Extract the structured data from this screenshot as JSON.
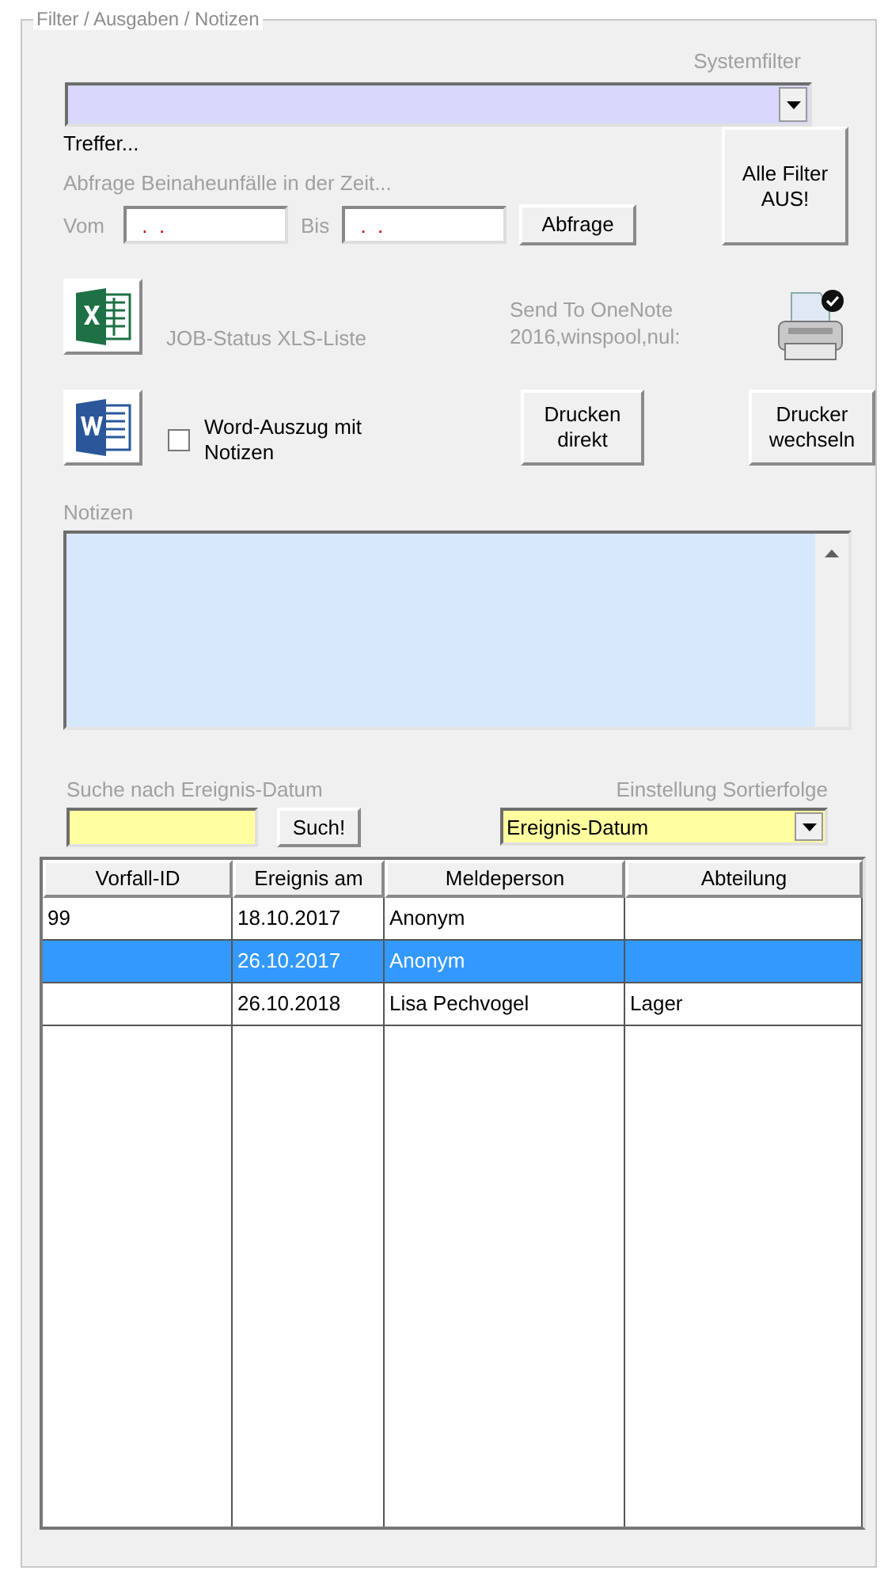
{
  "group": {
    "title": "Filter / Ausgaben / Notizen"
  },
  "systemfilter": {
    "label": "Systemfilter"
  },
  "hits": "Treffer...",
  "query": {
    "label": "Abfrage Beinaheunfälle in der Zeit...",
    "from_label": "Vom",
    "from_value": " .  .",
    "to_label": "Bis",
    "to_value": " .  .",
    "button": "Abfrage"
  },
  "reset_button": "Alle Filter AUS!",
  "excel": {
    "label": "JOB-Status XLS-Liste"
  },
  "printer": {
    "name": "Send To OneNote 2016,winspool,nul:"
  },
  "word": {
    "checkbox_label": "Word-Auszug mit Notizen",
    "checked": false
  },
  "print_button": "Drucken direkt",
  "change_printer_button": "Drucker wechseln",
  "notes": {
    "label": "Notizen"
  },
  "search": {
    "label": "Suche nach Ereignis-Datum",
    "button": "Such!"
  },
  "sort": {
    "label": "Einstellung Sortierfolge",
    "value": "Ereignis-Datum"
  },
  "table": {
    "columns": [
      "Vorfall-ID",
      "Ereignis am",
      "Meldeperson",
      "Abteilung"
    ],
    "rows": [
      {
        "cells": [
          "99",
          "18.10.2017",
          "Anonym",
          ""
        ],
        "selected": false
      },
      {
        "cells": [
          "",
          "26.10.2017",
          "Anonym",
          ""
        ],
        "selected": true
      },
      {
        "cells": [
          "",
          "26.10.2018",
          "Lisa Pechvogel",
          "Lager"
        ],
        "selected": false
      }
    ]
  }
}
